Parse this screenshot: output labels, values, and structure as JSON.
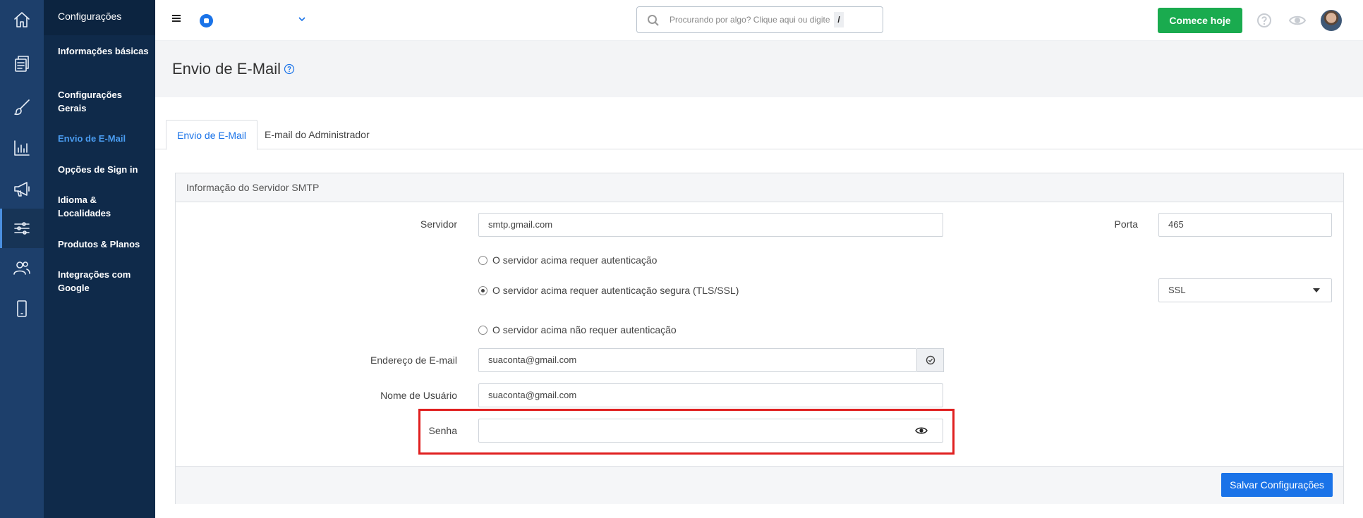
{
  "rail": {
    "items": [
      {
        "icon": "home-icon"
      },
      {
        "icon": "documents-icon"
      },
      {
        "icon": "brush-icon"
      },
      {
        "icon": "analytics-icon"
      },
      {
        "icon": "megaphone-icon"
      },
      {
        "icon": "settings-sliders-icon",
        "active": true
      },
      {
        "icon": "users-icon"
      },
      {
        "icon": "mobile-icon"
      }
    ]
  },
  "sidebar": {
    "title": "Configurações",
    "items": [
      {
        "label": "Informações básicas"
      },
      {
        "label": "Configurações Gerais"
      },
      {
        "label": "Envio de E-Mail",
        "active": true
      },
      {
        "label": "Opções de Sign in"
      },
      {
        "label": "Idioma & Localidades"
      },
      {
        "label": "Produtos & Planos"
      },
      {
        "label": "Integrações com Google"
      }
    ]
  },
  "topbar": {
    "search_placeholder": "Procurando por algo? Clique aqui ou digite",
    "search_shortcut": "/",
    "cta_label": "Comece hoje"
  },
  "page": {
    "title": "Envio de E-Mail"
  },
  "tabs": [
    {
      "label": "Envio de E-Mail",
      "active": true
    },
    {
      "label": "E-mail do Administrador",
      "active": false
    }
  ],
  "smtp": {
    "panel_title": "Informação do Servidor SMTP",
    "server_label": "Servidor",
    "server_value": "smtp.gmail.com",
    "port_label": "Porta",
    "port_value": "465",
    "auth_options": [
      {
        "label": "O servidor acima requer autenticação",
        "checked": false
      },
      {
        "label": "O servidor acima requer autenticação segura (TLS/SSL)",
        "checked": true
      },
      {
        "label": "O servidor acima não requer autenticação",
        "checked": false
      }
    ],
    "security_select": "SSL",
    "email_label": "Endereço de E-mail",
    "email_value": "suaconta@gmail.com",
    "username_label": "Nome de Usuário",
    "username_value": "suaconta@gmail.com",
    "password_label": "Senha",
    "password_value": "",
    "save_label": "Salvar Configurações"
  },
  "colors": {
    "rail_bg": "#1d3f6b",
    "sidebar_bg": "#0f2a4a",
    "accent": "#1a73e8",
    "cta": "#1aab4f",
    "highlight": "#e02020"
  }
}
